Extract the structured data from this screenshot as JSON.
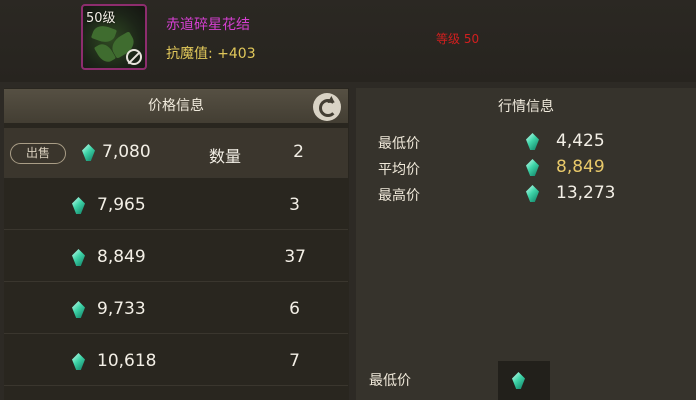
{
  "item": {
    "level_badge": "50级",
    "name": "赤道碎星花结",
    "stat": "抗魔值: +403",
    "level_requirement": "等级 50",
    "icon": "flower-ornament-icon",
    "status_icon": "forbidden-icon",
    "name_color": "#d43fd0"
  },
  "price_panel": {
    "title": "价格信息",
    "refresh_icon": "refresh-icon",
    "sell_button": "出售",
    "quantity_label": "数量",
    "listings": [
      {
        "price": "7,080",
        "quantity": "2"
      },
      {
        "price": "7,965",
        "quantity": "3"
      },
      {
        "price": "8,849",
        "quantity": "37"
      },
      {
        "price": "9,733",
        "quantity": "6"
      },
      {
        "price": "10,618",
        "quantity": "7"
      }
    ]
  },
  "market_panel": {
    "title": "行情信息",
    "stats": [
      {
        "label": "最低价",
        "value": "4,425"
      },
      {
        "label": "平均价",
        "value": "8,849"
      },
      {
        "label": "最高价",
        "value": "13,273"
      }
    ],
    "bottom_label": "最低价",
    "currency_icon": "green-crystal-icon",
    "avg_color": "#e8c96a"
  }
}
